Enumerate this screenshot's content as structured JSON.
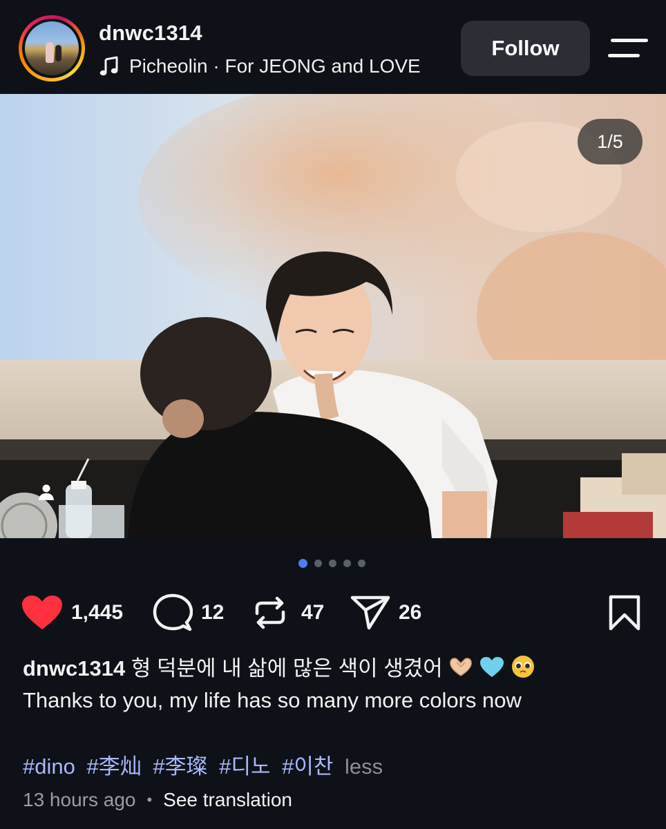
{
  "header": {
    "username": "dnwc1314",
    "music": "Picheolin · For JEONG and LOVE",
    "follow_label": "Follow",
    "menu_icon": "menu-icon"
  },
  "post": {
    "image_counter": "1/5",
    "carousel": {
      "total": 5,
      "active_index": 0
    },
    "image_description_icons": [
      "tagged-people-icon"
    ]
  },
  "actions": {
    "likes": "1,445",
    "comments": "12",
    "reposts": "47",
    "shares": "26",
    "liked": true
  },
  "caption": {
    "username": "dnwc1314",
    "korean_text": "형 덕분에 내 삶에 많은 색이 생겼어",
    "emojis": [
      "heart-hands",
      "light-blue-heart",
      "pleading-face"
    ],
    "english_text": "Thanks to you, my life has so many more colors now"
  },
  "hashtags": {
    "tags": [
      "#dino",
      "#李灿",
      "#李璨",
      "#디노",
      "#이찬"
    ],
    "less_label": "less"
  },
  "meta": {
    "time_ago": "13 hours ago",
    "translate_label": "See translation"
  },
  "colors": {
    "background": "#0e1117",
    "follow_button": "#2b2e35",
    "like_heart": "#ff3040",
    "hashtag": "#a9b8ff",
    "active_dot": "#4f7cf0"
  }
}
